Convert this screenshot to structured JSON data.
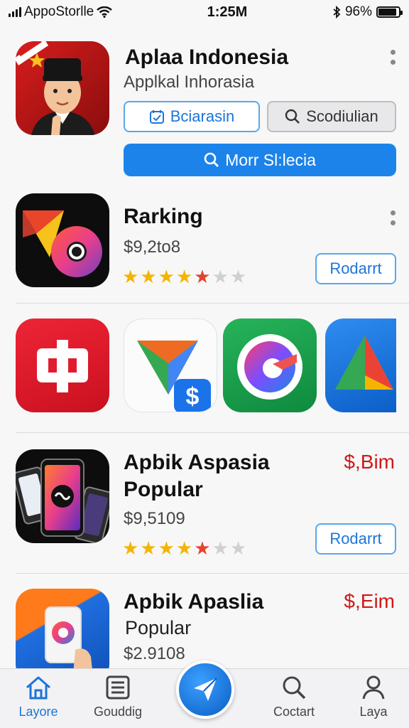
{
  "status_bar": {
    "carrier": "AppoStorlle",
    "time": "1:25M",
    "battery_percent": "96%"
  },
  "featured": {
    "title": "Aplaa Indonesia",
    "subtitle": "Applkal Inhorasia",
    "button_left": "Bciarasin",
    "button_right": "Scodiulian",
    "primary_button": "Morr Sl:lecia"
  },
  "ranking": {
    "title": "Rarking",
    "price": "$9,2to8",
    "rating": 4,
    "action": "Rodarrt"
  },
  "app_row": {
    "icons": [
      "red-app-icon",
      "triangle-dollar-app-icon",
      "g-swirl-app-icon",
      "triangle-app-icon"
    ]
  },
  "popular_1": {
    "title_line1": "Apbik Aspasia",
    "title_line2": "Popular",
    "price": "$9,5109",
    "price_tag": "$,Bim",
    "rating": 4,
    "action": "Rodarrt"
  },
  "popular_2": {
    "title_line1": "Apbik Apaslia",
    "title_line2": "Popular",
    "price": "$2.9108",
    "price_tag": "$,Eim"
  },
  "tabs": [
    {
      "label": "Layore",
      "icon": "home-icon"
    },
    {
      "label": "Gouddig",
      "icon": "list-icon"
    },
    {
      "label": "",
      "icon": "paper-plane-icon"
    },
    {
      "label": "Coctart",
      "icon": "search-icon"
    },
    {
      "label": "Laya",
      "icon": "person-icon"
    }
  ],
  "colors": {
    "accent": "#1c83ea",
    "price_red": "#d01818",
    "star": "#f4b400"
  }
}
